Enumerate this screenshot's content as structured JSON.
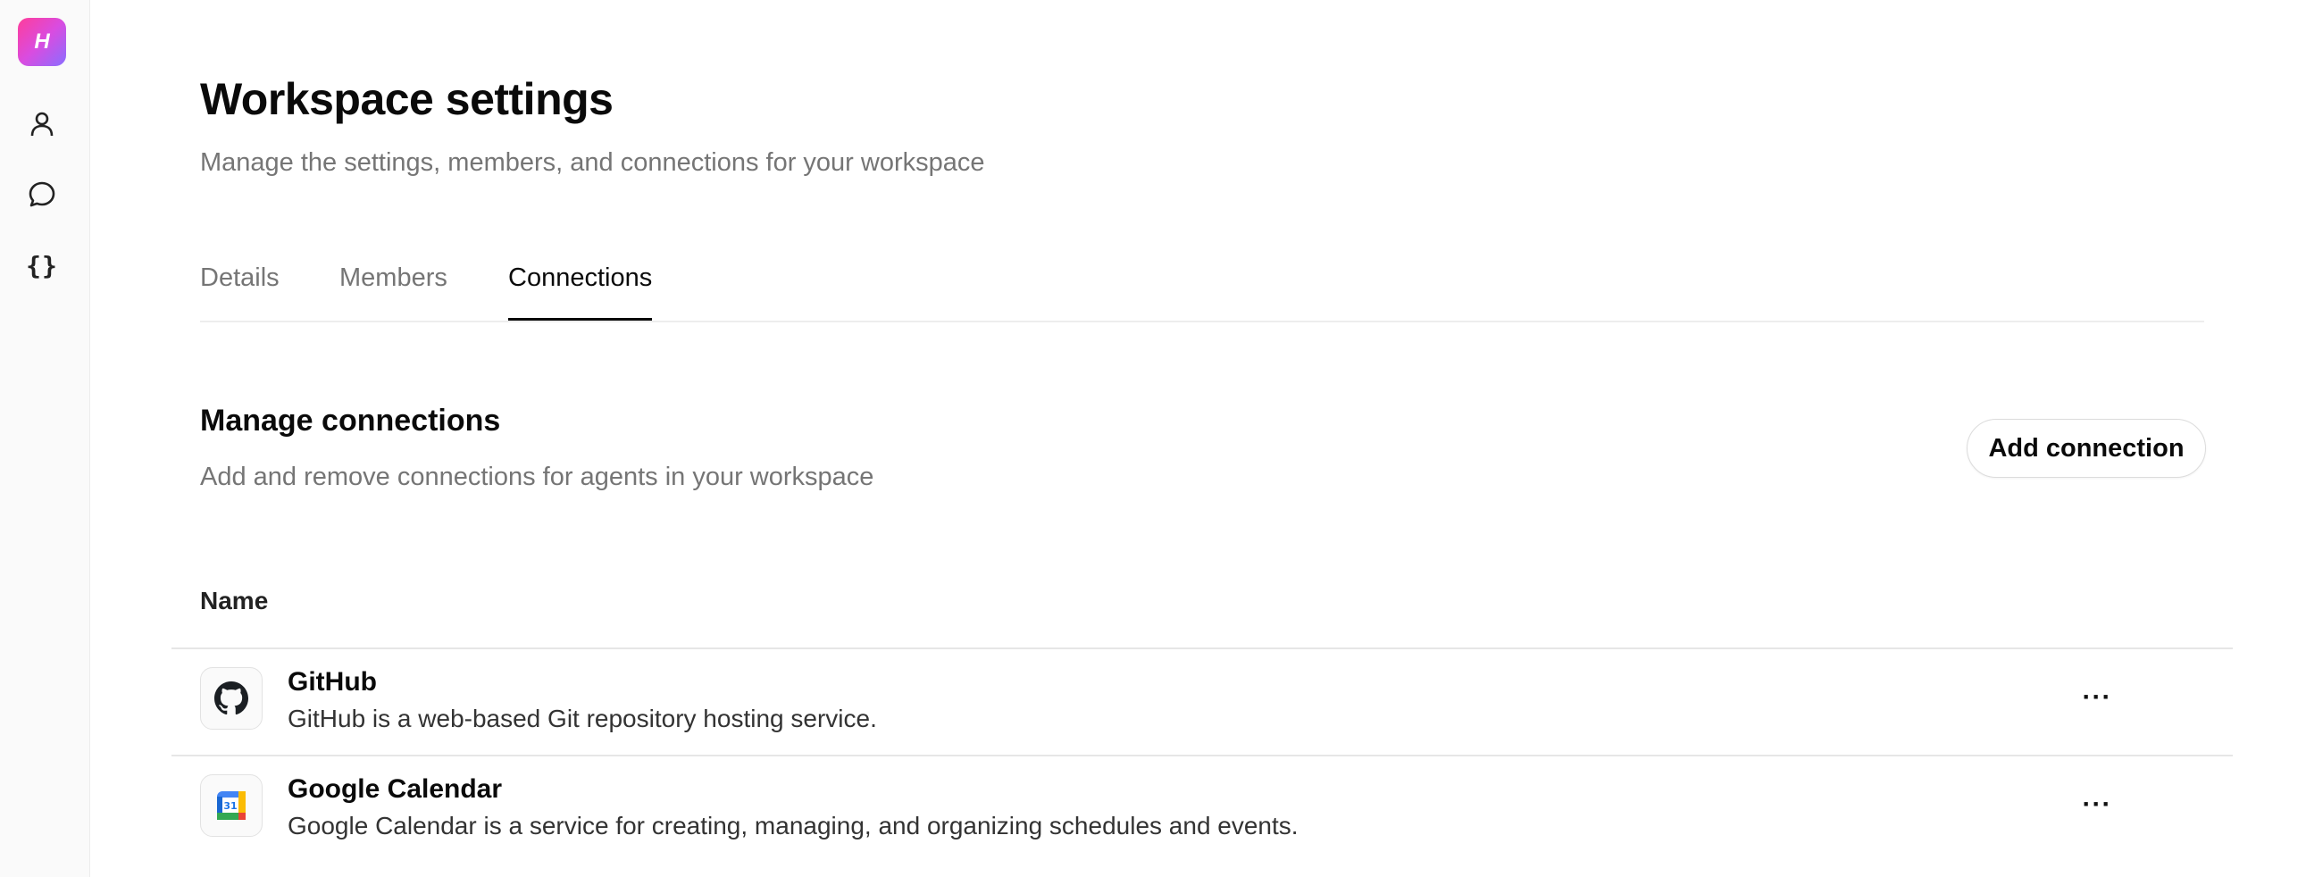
{
  "app": {
    "logo_letter": "H"
  },
  "sidebar": {
    "items": [
      {
        "icon": "user-icon"
      },
      {
        "icon": "chat-bubble-icon"
      },
      {
        "icon": "braces-icon",
        "glyph": "{}"
      }
    ]
  },
  "page": {
    "title": "Workspace settings",
    "subtitle": "Manage the settings, members, and connections for your workspace"
  },
  "tabs": [
    {
      "label": "Details",
      "active": false
    },
    {
      "label": "Members",
      "active": false
    },
    {
      "label": "Connections",
      "active": true
    }
  ],
  "section": {
    "title": "Manage connections",
    "subtitle": "Add and remove connections for agents in your workspace",
    "add_button_label": "Add connection"
  },
  "table": {
    "column_header": "Name",
    "rows": [
      {
        "name": "GitHub",
        "description": "GitHub is a web-based Git repository hosting service.",
        "icon": "github-icon",
        "menu": "···"
      },
      {
        "name": "Google Calendar",
        "description": "Google Calendar is a service for creating, managing, and organizing schedules and events.",
        "icon": "google-calendar-icon",
        "calendar_day": "31",
        "menu": "···"
      }
    ]
  },
  "colors": {
    "accent": "#0a0a0a",
    "muted_text": "#757575",
    "logo_gradient": [
      "#ff3d9a",
      "#8a6dff"
    ]
  }
}
